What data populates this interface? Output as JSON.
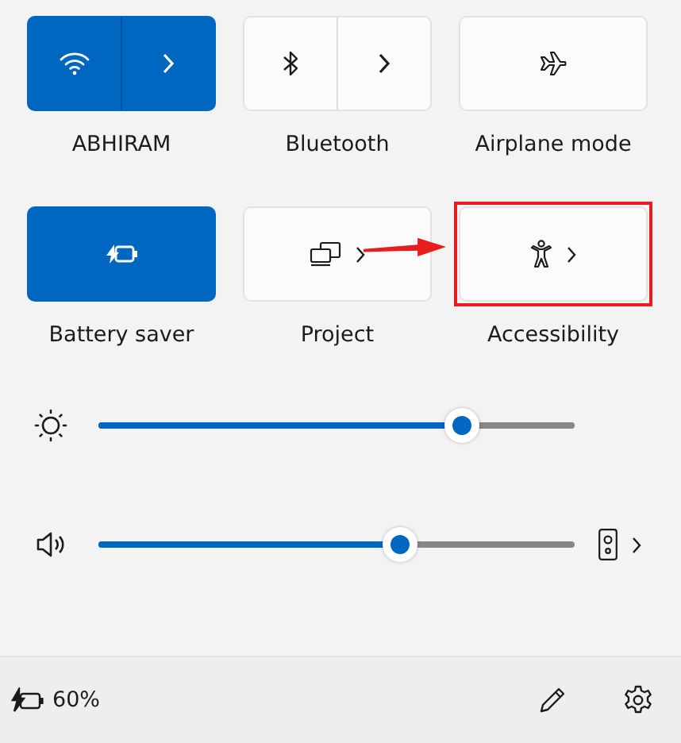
{
  "tiles": [
    {
      "label": "ABHIRAM",
      "kind": "split",
      "on": true,
      "highlighted": false
    },
    {
      "label": "Bluetooth",
      "kind": "split",
      "on": false,
      "highlighted": false
    },
    {
      "label": "Airplane mode",
      "kind": "single",
      "on": false,
      "highlighted": false
    },
    {
      "label": "Battery saver",
      "kind": "single",
      "on": true,
      "highlighted": false
    },
    {
      "label": "Project",
      "kind": "chevron",
      "on": false,
      "highlighted": false
    },
    {
      "label": "Accessibility",
      "kind": "chevron",
      "on": false,
      "highlighted": true
    }
  ],
  "sliders": [
    {
      "kind": "brightness",
      "level": 0.71,
      "output_chevron": false
    },
    {
      "kind": "volume",
      "level": 0.59,
      "output_chevron": true
    }
  ],
  "footer": {
    "battery": "60%"
  }
}
